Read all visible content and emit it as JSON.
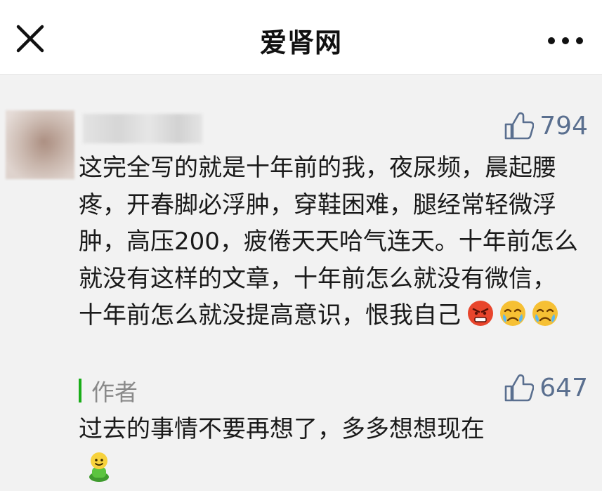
{
  "header": {
    "title": "爱肾网",
    "close_icon": "close-icon",
    "more_icon": "more-icon"
  },
  "comment": {
    "likes": "794",
    "text": "这完全写的就是十年前的我，夜尿频，晨起腰疼，开春脚必浮肿，穿鞋困难，腿经常轻微浮肿，高压200，疲倦天天哈气连天。十年前怎么就没有这样的文章，十年前怎么就没有微信，十年前怎么就没提高意识，恨我自己",
    "emojis": [
      "angry-face-icon",
      "crying-face-icon",
      "crying-face-icon"
    ]
  },
  "reply": {
    "author_label": "作者",
    "likes": "647",
    "text": "过去的事情不要再想了，多多想想现在",
    "emoji": "green-doll-icon"
  },
  "colors": {
    "header_bg": "#ffffff",
    "page_bg": "#f2f2f2",
    "like_color": "#5a6f8f",
    "author_accent": "#1aad19"
  }
}
